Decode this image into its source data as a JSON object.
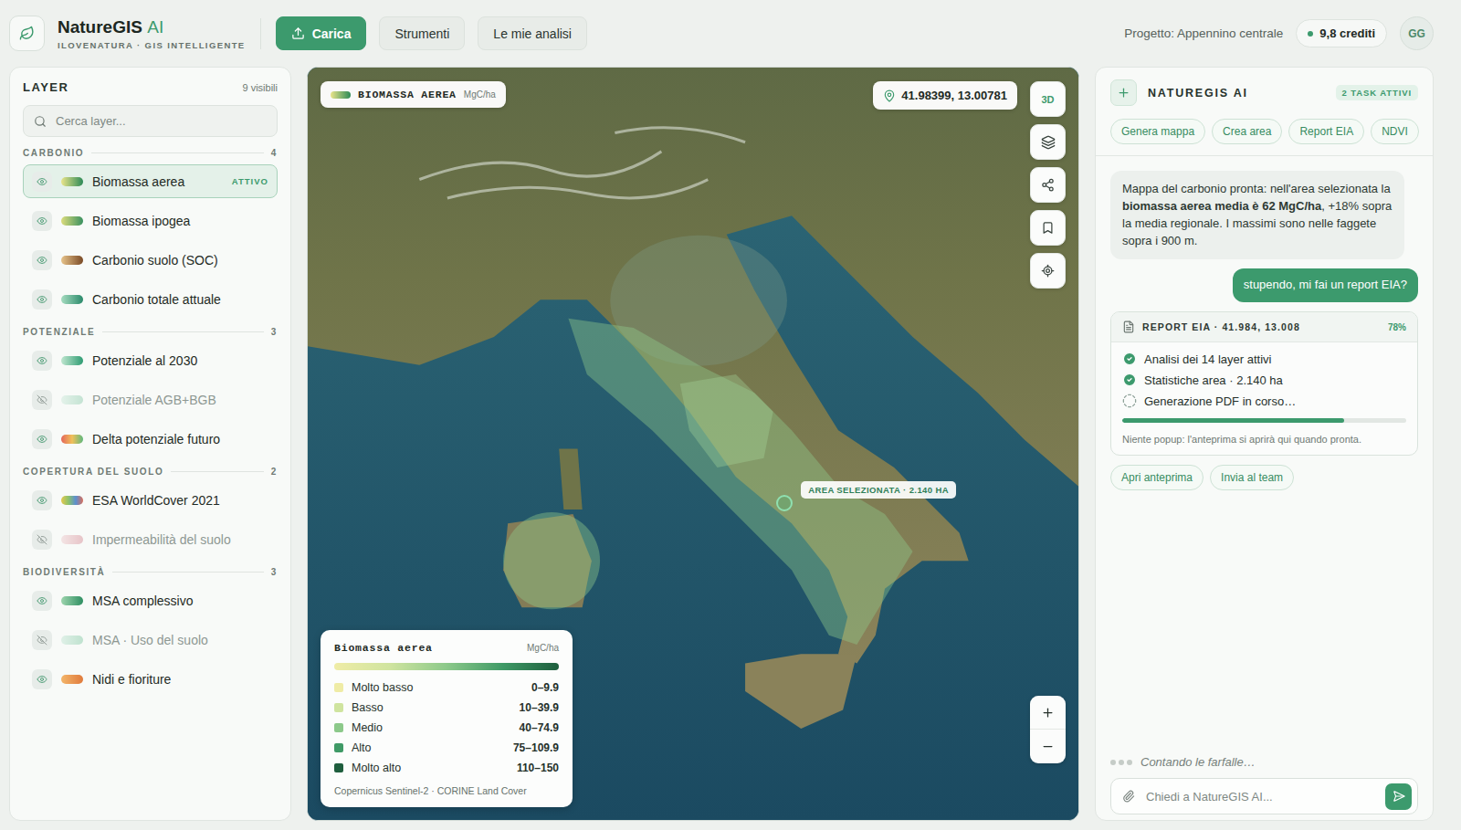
{
  "app": {
    "name": "NatureGIS",
    "accent": "AI",
    "tagline": "ILOVENATURA · GIS INTELLIGENTE"
  },
  "toolbar": [
    {
      "label": "Carica",
      "selected": true
    },
    {
      "label": "Strumenti",
      "selected": false
    },
    {
      "label": "Le mie analisi",
      "selected": false
    }
  ],
  "project": "Progetto: Appennino centrale",
  "credits": "9,8 crediti",
  "avatar": "GG",
  "layers_panel": {
    "title": "LAYER",
    "count": "9 visibili",
    "search_placeholder": "Cerca layer...",
    "groups": [
      {
        "title": "CARBONIO",
        "count": "4",
        "items": [
          {
            "label": "Biomassa aerea",
            "visible": true,
            "selected": true,
            "badge": "ATTIVO",
            "colors": [
              "#e9e48a",
              "#2d8a57"
            ]
          },
          {
            "label": "Biomassa ipogea",
            "visible": true,
            "selected": false,
            "colors": [
              "#dcdc7c",
              "#3a9160"
            ]
          },
          {
            "label": "Carbonio suolo (SOC)",
            "visible": true,
            "selected": false,
            "colors": [
              "#e7c38a",
              "#7a4a26"
            ]
          },
          {
            "label": "Carbonio totale attuale",
            "visible": true,
            "selected": false,
            "colors": [
              "#a6dcc0",
              "#2b8a6b"
            ]
          }
        ]
      },
      {
        "title": "POTENZIALE",
        "count": "3",
        "items": [
          {
            "label": "Potenziale al 2030",
            "visible": true,
            "selected": false,
            "colors": [
              "#bfe6cf",
              "#2f9c73"
            ]
          },
          {
            "label": "Potenziale AGB+BGB",
            "visible": false,
            "selected": false,
            "colors": [
              "#e4f2ea",
              "#c4e3d3"
            ]
          },
          {
            "label": "Delta potenziale futuro",
            "visible": true,
            "selected": false,
            "colors": [
              "#e4665a",
              "#f0c05a",
              "#5fb87d"
            ]
          }
        ]
      },
      {
        "title": "COPERTURA DEL SUOLO",
        "count": "2",
        "items": [
          {
            "label": "ESA WorldCover 2021",
            "visible": true,
            "selected": false,
            "colors": [
              "#e6c84e",
              "#8cc26b",
              "#5b8fd0",
              "#d96f5a"
            ]
          },
          {
            "label": "Impermeabilità del suolo",
            "visible": false,
            "selected": false,
            "colors": [
              "#f3e4e4",
              "#e7c4c8"
            ]
          }
        ]
      },
      {
        "title": "BIODIVERSITÀ",
        "count": "3",
        "items": [
          {
            "label": "MSA complessivo",
            "visible": true,
            "selected": false,
            "colors": [
              "#9dd4ad",
              "#2f8f62"
            ]
          },
          {
            "label": "MSA · Uso del suolo",
            "visible": false,
            "selected": false,
            "colors": [
              "#dff0e7",
              "#bfe2cf"
            ]
          },
          {
            "label": "Nidi e fioriture",
            "visible": true,
            "selected": false,
            "colors": [
              "#f3b56a",
              "#e07b3c"
            ]
          }
        ]
      }
    ]
  },
  "map": {
    "layer_chip": {
      "title": "BIOMASSA AEREA",
      "unit": "MgC/ha",
      "colors": [
        "#e9e48a",
        "#2d8a57"
      ]
    },
    "coordinates": "41.98399, 13.00781",
    "view_toggle": "3D",
    "selection_label": "AREA SELEZIONATA · 2.140 HA",
    "legend": {
      "title": "Biomassa aerea",
      "unit": "MgC/ha",
      "classes": [
        {
          "label": "Molto basso",
          "range": "0–9.9",
          "color": "#efeca6"
        },
        {
          "label": "Basso",
          "range": "10–39.9",
          "color": "#cfe49f"
        },
        {
          "label": "Medio",
          "range": "40–74.9",
          "color": "#8cc98a"
        },
        {
          "label": "Alto",
          "range": "75–109.9",
          "color": "#3f9a66"
        },
        {
          "label": "Molto alto",
          "range": "110–150",
          "color": "#1e5e3d"
        }
      ],
      "source": "Copernicus Sentinel-2 · CORINE Land Cover"
    }
  },
  "assistant": {
    "title": "NATUREGIS AI",
    "badge": "2 TASK ATTIVI",
    "quick_actions": [
      "Genera mappa",
      "Crea area",
      "Report EIA",
      "NDVI"
    ],
    "messages": [
      {
        "role": "assistant",
        "segments": [
          {
            "text": "Mappa del carbonio pronta: nell'area selezionata la ",
            "bold": false
          },
          {
            "text": "biomassa aerea media è 62 MgC/ha",
            "bold": true
          },
          {
            "text": ", +18% sopra la media regionale. I massimi sono nelle faggete sopra i 900 m.",
            "bold": false
          }
        ]
      },
      {
        "role": "user",
        "segments": [
          {
            "text": "stupendo, mi fai un report EIA?",
            "bold": false
          }
        ]
      }
    ],
    "task": {
      "title": "REPORT EIA · 41.984, 13.008",
      "percent": "78%",
      "level": 0.78,
      "steps": [
        {
          "label": "Analisi dei 14 layer attivi",
          "done": true
        },
        {
          "label": "Statistiche area · 2.140 ha",
          "done": true
        },
        {
          "label": "Generazione PDF in corso…",
          "done": false
        }
      ],
      "note": "Niente popup: l'anteprima si aprirà qui quando pronta."
    },
    "task_actions": [
      "Apri anteprima",
      "Invia al team"
    ],
    "typing": "Contando le farfalle…",
    "input_placeholder": "Chiedi a NatureGIS AI..."
  }
}
